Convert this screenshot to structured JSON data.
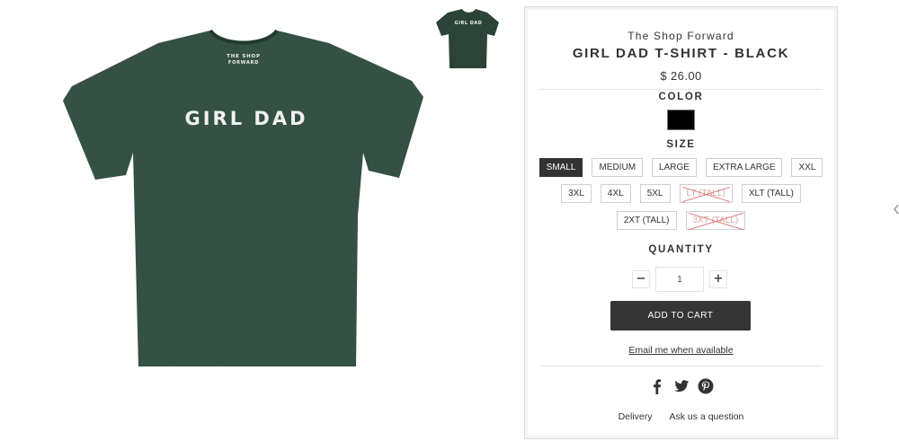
{
  "product": {
    "vendor": "The Shop Forward",
    "title": "GIRL DAD T-SHIRT - BLACK",
    "price": "$ 26.00",
    "image": {
      "shirt_text": "GIRL DAD",
      "collar_text_line1": "THE SHOP",
      "collar_text_line2": "FORWARD",
      "shirt_color": "#2c4437"
    }
  },
  "options": {
    "color_label": "COLOR",
    "colors": [
      {
        "name": "Black",
        "hex": "#000000",
        "selected": true
      }
    ],
    "size_label": "SIZE",
    "size_rows": [
      [
        {
          "label": "SMALL",
          "selected": true,
          "sold_out": false
        },
        {
          "label": "MEDIUM",
          "selected": false,
          "sold_out": false
        },
        {
          "label": "LARGE",
          "selected": false,
          "sold_out": false
        },
        {
          "label": "EXTRA LARGE",
          "selected": false,
          "sold_out": false
        },
        {
          "label": "XXL",
          "selected": false,
          "sold_out": false
        }
      ],
      [
        {
          "label": "3XL",
          "selected": false,
          "sold_out": false
        },
        {
          "label": "4XL",
          "selected": false,
          "sold_out": false
        },
        {
          "label": "5XL",
          "selected": false,
          "sold_out": false
        },
        {
          "label": "LT (TALL)",
          "selected": false,
          "sold_out": true
        },
        {
          "label": "XLT (TALL)",
          "selected": false,
          "sold_out": false
        }
      ],
      [
        {
          "label": "2XT (TALL)",
          "selected": false,
          "sold_out": false
        },
        {
          "label": "3XT (TALL)",
          "selected": false,
          "sold_out": true
        }
      ]
    ]
  },
  "quantity": {
    "label": "QUANTITY",
    "value": "1",
    "minus": "−",
    "plus": "+"
  },
  "actions": {
    "add_to_cart": "ADD TO CART",
    "notify": "Email me when available"
  },
  "share": {
    "icons": [
      "facebook-icon",
      "twitter-icon",
      "pinterest-icon"
    ]
  },
  "footer_links": {
    "delivery": "Delivery",
    "ask": "Ask us a question"
  },
  "colors": {
    "accent_dark": "#353535",
    "sold_out_strike": "#e17f7f"
  }
}
